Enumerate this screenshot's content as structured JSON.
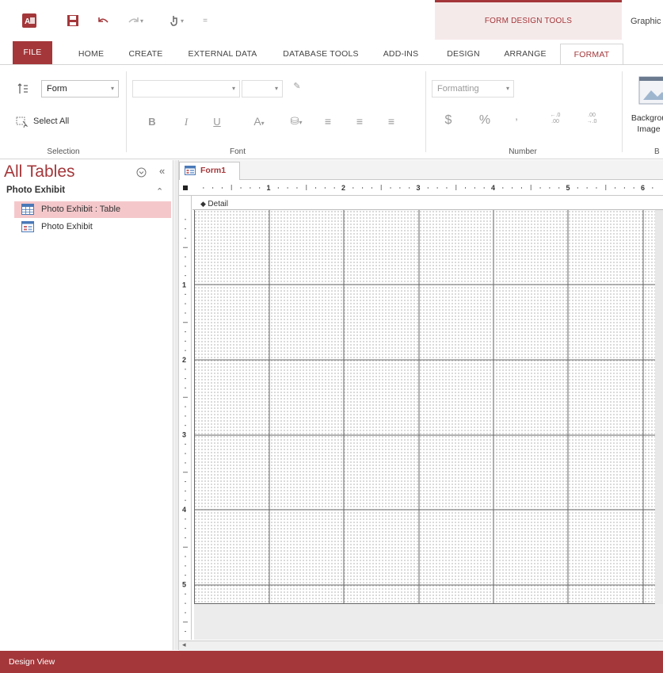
{
  "qat": {
    "redo_caret": "▾",
    "touch_caret": "▾",
    "customize": "="
  },
  "context_tab": {
    "label": "FORM DESIGN TOOLS"
  },
  "window": {
    "title": "Graphic"
  },
  "tabs": [
    "FILE",
    "HOME",
    "CREATE",
    "EXTERNAL DATA",
    "DATABASE TOOLS",
    "ADD-INS",
    "DESIGN",
    "ARRANGE",
    "FORMAT"
  ],
  "ribbon": {
    "selection": {
      "object_value": "Form",
      "select_all": "Select All",
      "label": "Selection"
    },
    "font": {
      "bold": "B",
      "italic": "I",
      "underline": "U",
      "font_color": "A",
      "label": "Font"
    },
    "number": {
      "format_placeholder": "Formatting",
      "currency": "$",
      "percent": "%",
      "comma": "’",
      "label": "Number"
    },
    "background": {
      "image_label_1": "Backgrou",
      "image_label_2": "Image",
      "group_label_partial": "B"
    }
  },
  "nav": {
    "title": "All Tables",
    "group": "Photo Exhibit",
    "items": [
      {
        "label": "Photo Exhibit : Table",
        "selected": true
      },
      {
        "label": "Photo Exhibit",
        "selected": false
      }
    ]
  },
  "document": {
    "tab": "Form1",
    "section": "Detail",
    "ruler_h": [
      "1",
      "2",
      "3",
      "4",
      "5",
      "6"
    ],
    "ruler_v": [
      "1",
      "2",
      "3",
      "4",
      "5"
    ]
  },
  "status": {
    "text": "Design View"
  },
  "colors": {
    "accent": "#a4373a",
    "selected_item": "#f4c8cb"
  }
}
